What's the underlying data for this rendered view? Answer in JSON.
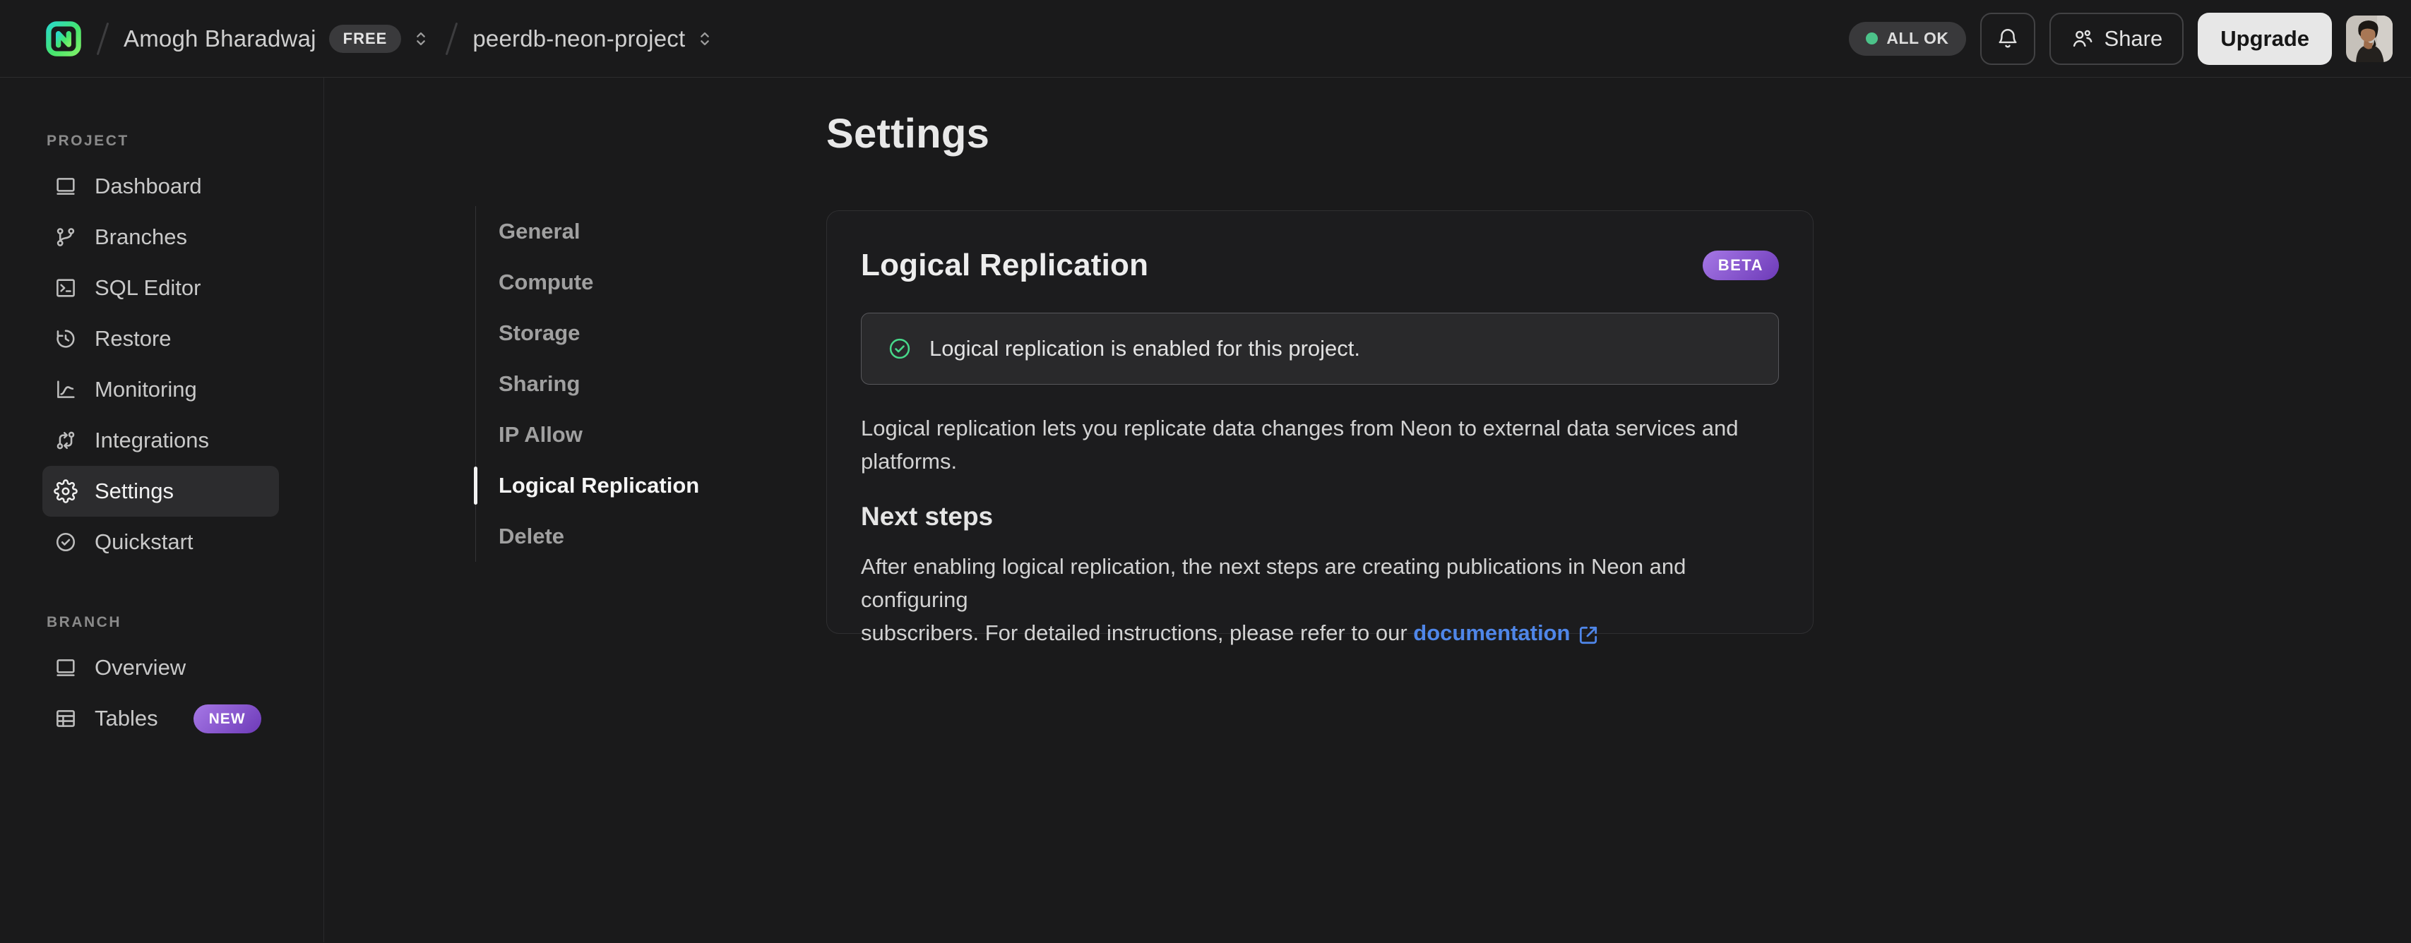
{
  "topbar": {
    "org_name": "Amogh Bharadwaj",
    "plan_badge": "FREE",
    "project_name": "peerdb-neon-project",
    "status_label": "ALL OK",
    "share_label": "Share",
    "upgrade_label": "Upgrade"
  },
  "sidebar": {
    "sections": {
      "project": "PROJECT",
      "branch": "BRANCH"
    },
    "project_items": [
      {
        "icon": "dashboard-icon",
        "label": "Dashboard"
      },
      {
        "icon": "git-branch-icon",
        "label": "Branches"
      },
      {
        "icon": "sql-editor-icon",
        "label": "SQL Editor"
      },
      {
        "icon": "restore-history-icon",
        "label": "Restore"
      },
      {
        "icon": "monitoring-chart-icon",
        "label": "Monitoring"
      },
      {
        "icon": "integrations-icon",
        "label": "Integrations"
      },
      {
        "icon": "gear-icon",
        "label": "Settings",
        "active": true
      },
      {
        "icon": "check-circle-icon",
        "label": "Quickstart"
      }
    ],
    "branch_items": [
      {
        "icon": "overview-window-icon",
        "label": "Overview"
      },
      {
        "icon": "tables-grid-icon",
        "label": "Tables",
        "badge": "NEW"
      }
    ]
  },
  "main": {
    "page_title": "Settings",
    "nav": {
      "items": [
        "General",
        "Compute",
        "Storage",
        "Sharing",
        "IP Allow",
        "Logical Replication",
        "Delete"
      ],
      "active": "Logical Replication"
    },
    "card": {
      "title": "Logical Replication",
      "beta_badge": "BETA",
      "alert_text": "Logical replication is enabled for this project.",
      "description_line1": "Logical replication lets you replicate data changes from Neon to external data services and",
      "description_line2": "platforms.",
      "next_steps_title": "Next steps",
      "steps_line1": "After enabling logical replication, the next steps are creating publications in Neon and configuring",
      "steps_line2_prefix": "subscribers. For detailed instructions, please refer to our ",
      "doc_link_label": "documentation"
    }
  },
  "colors": {
    "brand_green_start": "#2bd9c7",
    "brand_green_end": "#7df068",
    "status_dot_green": "#4cc38a",
    "success_green": "#47d98a",
    "badge_purple_light": "#a678e6",
    "badge_purple_dark": "#6d3ab8",
    "link_blue": "#4f86e8",
    "background": "#1a1a1b"
  },
  "icons": [
    "neon-logo-icon",
    "breadcrumb-slash",
    "caret-sort-icon",
    "bell-icon",
    "share-users-icon",
    "dashboard-icon",
    "git-branch-icon",
    "sql-editor-icon",
    "restore-history-icon",
    "monitoring-chart-icon",
    "integrations-icon",
    "gear-icon",
    "check-circle-icon",
    "overview-window-icon",
    "tables-grid-icon",
    "success-check-circle-icon",
    "external-link-icon",
    "avatar"
  ]
}
